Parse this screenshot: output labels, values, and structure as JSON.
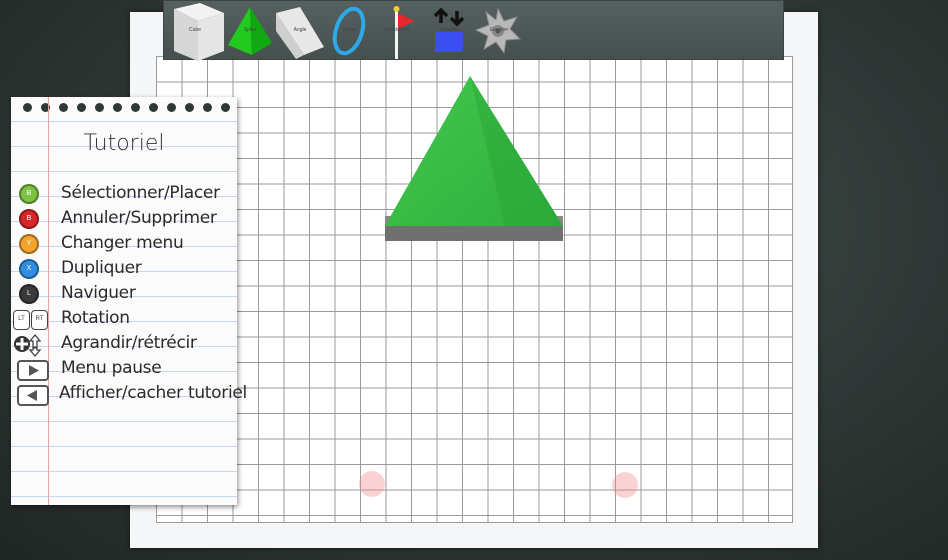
{
  "toolbar": {
    "items": [
      {
        "label": "Cube",
        "icon": "cube-icon"
      },
      {
        "label": "Spike",
        "icon": "pyramid-spike-icon"
      },
      {
        "label": "Angle",
        "icon": "wedge-angle-icon"
      },
      {
        "label": "Portal",
        "icon": "portal-ring-icon"
      },
      {
        "label": "Checkpoint",
        "icon": "checkpoint-flag-icon"
      },
      {
        "label": "Elevator",
        "icon": "elevator-arrows-icon"
      },
      {
        "label": "Elevator",
        "icon": "saw-blade-icon"
      }
    ]
  },
  "tutorial": {
    "title": "Tutoriel",
    "rows": [
      {
        "button": "B",
        "color": "#7dc242",
        "text": "Sélectionner/Placer"
      },
      {
        "button": "B",
        "color": "#d9262b",
        "text": "Annuler/Supprimer"
      },
      {
        "button": "Y",
        "color": "#f2a52c",
        "text": "Changer menu"
      },
      {
        "button": "X",
        "color": "#2f8ee0",
        "text": "Dupliquer"
      },
      {
        "button": "L",
        "color": "#3a3a3a",
        "text": "Naviguer"
      },
      {
        "button": "LT RT",
        "text": "Rotation"
      },
      {
        "button": "dpad",
        "text": "Agrandir/rétrécir"
      },
      {
        "button": "start",
        "text": "Menu pause"
      },
      {
        "button": "back",
        "text": "Afficher/cacher tutoriel"
      }
    ]
  },
  "colors": {
    "spike_green": "#3cbf48",
    "platform_grey": "#707070",
    "spawn_marker": "#f08c8c",
    "elevator_blue": "#3b4ef2"
  }
}
